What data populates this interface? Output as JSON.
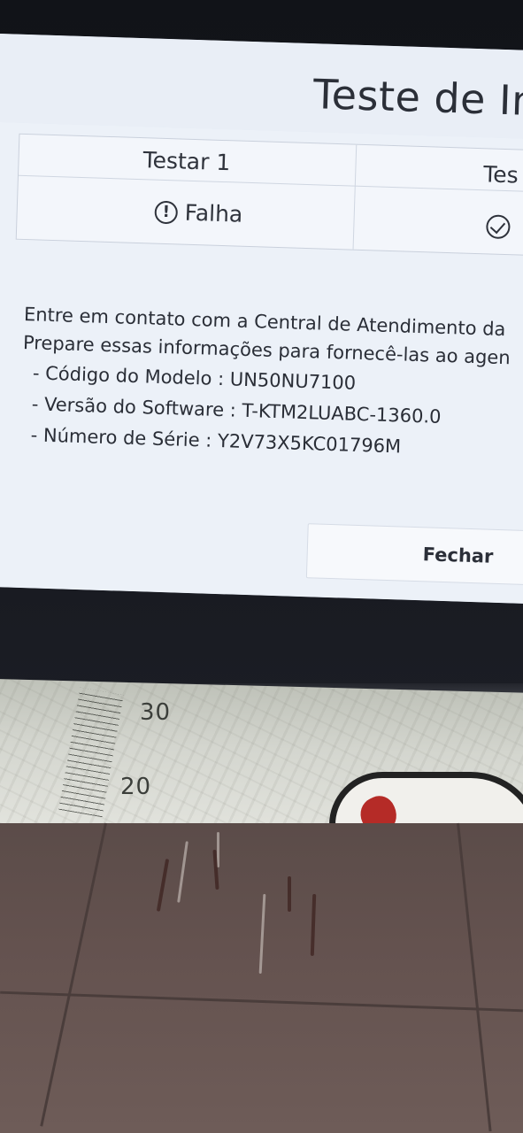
{
  "screen": {
    "title": "Teste de Ima",
    "table": {
      "col1_header": "Testar 1",
      "col2_header": "Tes",
      "col1_result": "Falha",
      "col1_icon": "warning-circle-icon",
      "col2_icon": "check-circle-icon"
    },
    "message": {
      "line1": "Entre em contato com a Central de Atendimento da",
      "line2": "Prepare essas informações para fornecê-las ao agen",
      "model": "- Código do Modelo : UN50NU7100",
      "software": "- Versão do Software : T-KTM2LUABC-1360.0",
      "serial": "- Número de Série : Y2V73X5KC01796M"
    },
    "close_button": "Fechar"
  },
  "mat": {
    "number_30": "30",
    "number_20": "20"
  },
  "colors": {
    "screen_bg": "#ecf1f8",
    "text": "#2a2e37",
    "floor": "#64524f",
    "bezel": "#111318"
  }
}
